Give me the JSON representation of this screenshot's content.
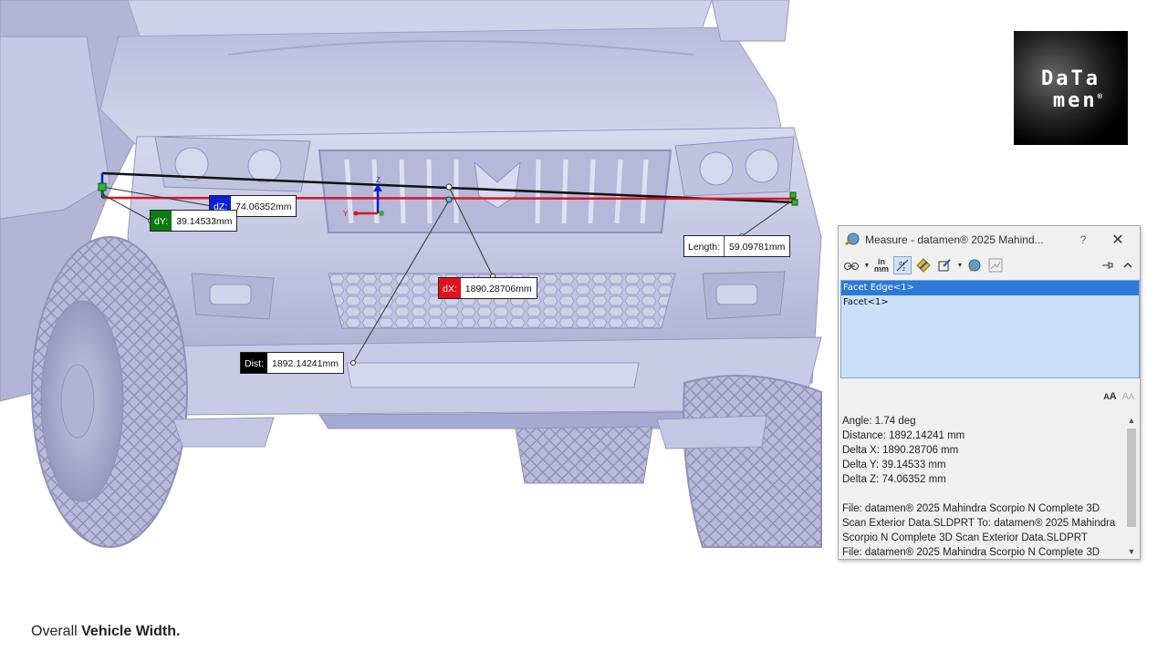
{
  "callouts": {
    "dz": {
      "label": "dZ:",
      "value": "74.06352mm",
      "color": "#0a1fd6"
    },
    "dy": {
      "label": "dY:",
      "value": "39.14533mm",
      "color": "#0a7a12"
    },
    "dx": {
      "label": "dX:",
      "value": "1890.28706mm",
      "color": "#e0121a"
    },
    "dist": {
      "label": "Dist:",
      "value": "1892.14241mm",
      "color": "#000000"
    },
    "length": {
      "label": "Length:",
      "value": "59.09781mm"
    }
  },
  "triad": {
    "z": "Z",
    "y": "Y"
  },
  "logo": {
    "line1": "DaTa",
    "line2": "men",
    "reg": "®"
  },
  "measure": {
    "title": "Measure - datamen® 2025 Mahind...",
    "help": "?",
    "close": "✕",
    "toolbar": {
      "units_top": "in",
      "units_bottom": "mm"
    },
    "selections": [
      "Facet Edge<1>",
      "Facet<1>"
    ],
    "results": [
      "Angle: 1.74 deg",
      "Distance: 1892.14241 mm",
      "Delta X: 1890.28706 mm",
      "Delta Y: 39.14533 mm",
      "Delta Z: 74.06352 mm",
      "",
      "File: datamen® 2025 Mahindra Scorpio N Complete 3D",
      "Scan Exterior Data.SLDPRT To: datamen® 2025 Mahindra",
      "Scorpio N Complete 3D Scan Exterior Data.SLDPRT",
      "File: datamen® 2025 Mahindra Scorpio N Complete 3D"
    ],
    "font_bigger": "A",
    "font_smaller": "A"
  },
  "caption": {
    "normal": "Overall ",
    "bold": "Vehicle Width."
  },
  "colors": {
    "body": "#c8cbe6",
    "accent_blue": "#2b79d8"
  }
}
